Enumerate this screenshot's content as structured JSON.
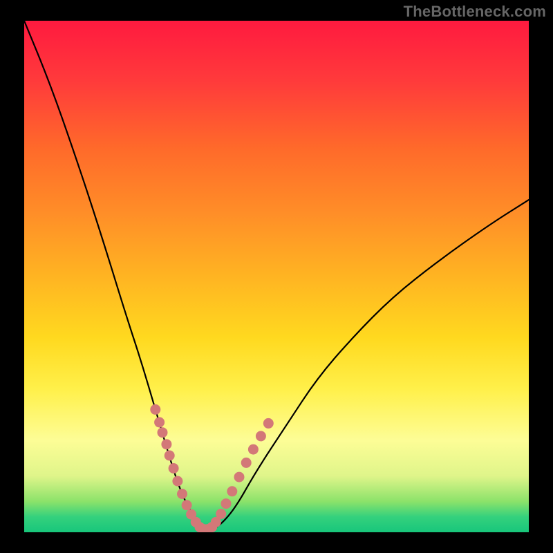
{
  "watermark": "TheBottleneck.com",
  "chart_data": {
    "type": "line",
    "title": "",
    "xlabel": "",
    "ylabel": "",
    "xlim": [
      0,
      100
    ],
    "ylim": [
      0,
      100
    ],
    "grid": false,
    "legend": false,
    "background_gradient": {
      "stops": [
        {
          "at": 0,
          "color": "#ff1a3f"
        },
        {
          "at": 25,
          "color": "#ff6a2a"
        },
        {
          "at": 50,
          "color": "#ffb422"
        },
        {
          "at": 72,
          "color": "#fff04a"
        },
        {
          "at": 89,
          "color": "#dff58a"
        },
        {
          "at": 100,
          "color": "#18c67b"
        }
      ]
    },
    "series": [
      {
        "name": "bottleneck-curve",
        "x": [
          0,
          5,
          10,
          15,
          20,
          23,
          26,
          29,
          31,
          33,
          35,
          37,
          39,
          42,
          46,
          52,
          58,
          65,
          73,
          82,
          92,
          100
        ],
        "y": [
          100,
          88,
          74,
          59,
          43,
          34,
          24,
          14,
          8,
          4,
          1.5,
          0.5,
          1.5,
          5,
          12,
          21,
          30,
          38,
          46,
          53,
          60,
          65
        ]
      }
    ],
    "points": {
      "name": "highlighted-range-dots",
      "color": "#d37878",
      "x": [
        26.0,
        26.8,
        27.4,
        28.2,
        28.8,
        29.6,
        30.4,
        31.3,
        32.2,
        33.1,
        34.0,
        34.8,
        35.6,
        36.4,
        37.2,
        38.0,
        39.0,
        40.0,
        41.2,
        42.6,
        44.0,
        45.4,
        46.9,
        48.4
      ],
      "y": [
        24.0,
        21.5,
        19.5,
        17.2,
        15.0,
        12.5,
        10.0,
        7.5,
        5.3,
        3.5,
        2.0,
        1.0,
        0.6,
        0.6,
        1.0,
        2.0,
        3.6,
        5.6,
        8.0,
        10.8,
        13.6,
        16.2,
        18.8,
        21.3
      ]
    }
  }
}
